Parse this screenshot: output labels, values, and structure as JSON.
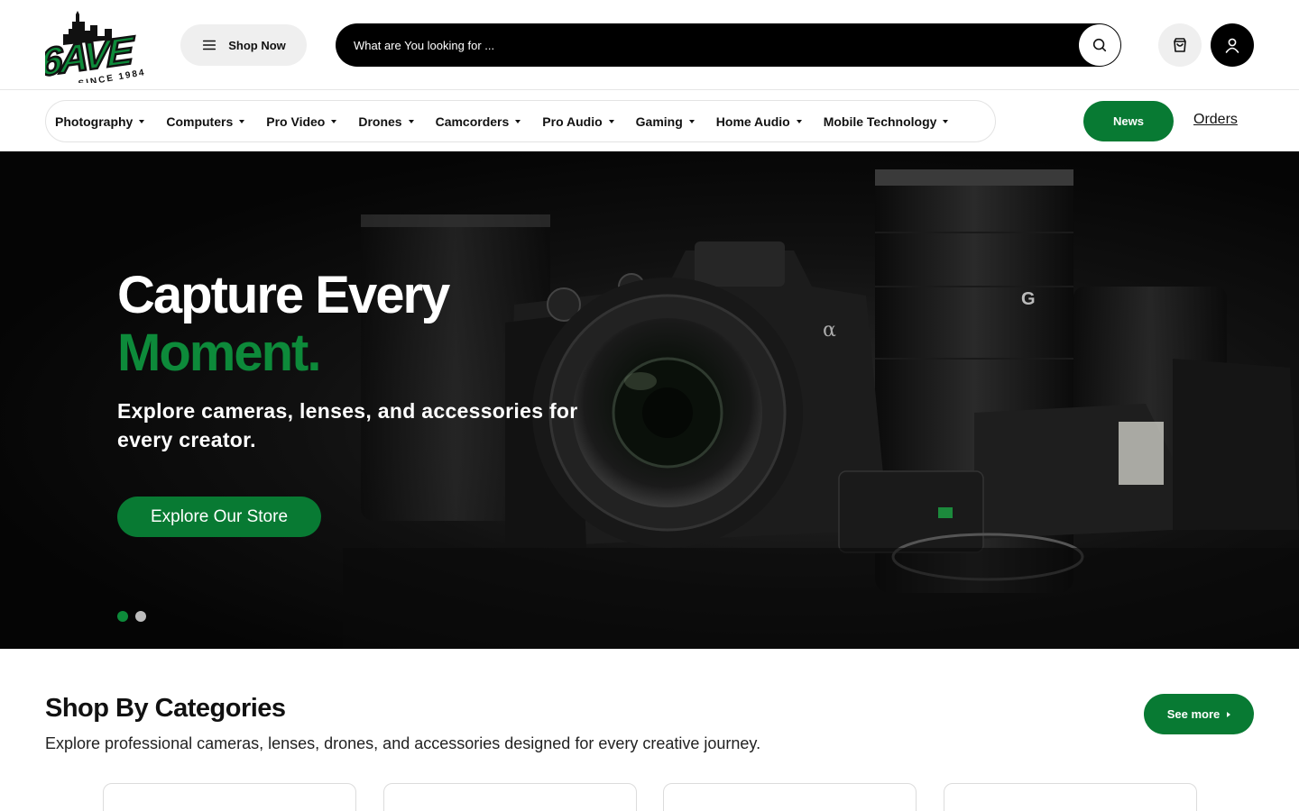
{
  "brand": {
    "logo_text": "6AVE",
    "logo_tagline": "SINCE 1984",
    "accent_color": "#087a33"
  },
  "header": {
    "shop_now_label": "Shop Now",
    "search_placeholder": "What are You looking for ...",
    "icons": [
      "menu-icon",
      "search-icon",
      "shopping-bag-icon",
      "user-icon"
    ]
  },
  "nav": {
    "categories": [
      {
        "label": "Photography"
      },
      {
        "label": "Computers"
      },
      {
        "label": "Pro Video"
      },
      {
        "label": "Drones"
      },
      {
        "label": "Camcorders"
      },
      {
        "label": "Pro Audio"
      },
      {
        "label": "Gaming"
      },
      {
        "label": "Home Audio"
      },
      {
        "label": "Mobile Technology"
      }
    ],
    "news_label": "News",
    "orders_label": "Orders"
  },
  "hero": {
    "title_line1": "Capture Every",
    "title_line2": "Moment.",
    "subtitle": "Explore cameras, lenses, and accessories for every creator.",
    "cta_label": "Explore Our Store",
    "slides_total": 2,
    "active_slide": 1
  },
  "categories_section": {
    "title": "Shop By Categories",
    "description": "Explore professional cameras, lenses, drones, and accessories designed for every creative journey.",
    "see_more_label": "See more"
  }
}
